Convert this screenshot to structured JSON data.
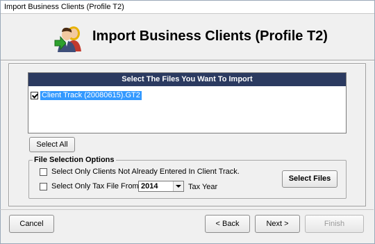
{
  "window": {
    "title": "Import Business Clients (Profile T2)"
  },
  "header": {
    "title": "Import Business Clients (Profile T2)",
    "icon": "people-import-icon"
  },
  "file_list": {
    "heading": "Select The Files You Want To Import",
    "items": [
      {
        "label": "Client Track (20080615).GT2",
        "checked": true
      }
    ]
  },
  "buttons": {
    "select_all": "Select All",
    "select_files": "Select Files",
    "cancel": "Cancel",
    "back": "< Back",
    "next": "Next >",
    "finish": "Finish"
  },
  "options": {
    "legend": "File Selection Options",
    "not_entered": {
      "label": "Select Only Clients Not Already Entered In Client Track.",
      "checked": false
    },
    "tax_file": {
      "label": "Select Only Tax File From The",
      "checked": false
    },
    "tax_year_value": "2014",
    "tax_year_suffix": "Tax Year"
  },
  "colors": {
    "list_header_bg": "#2b3a60",
    "selection_bg": "#3399ff"
  }
}
